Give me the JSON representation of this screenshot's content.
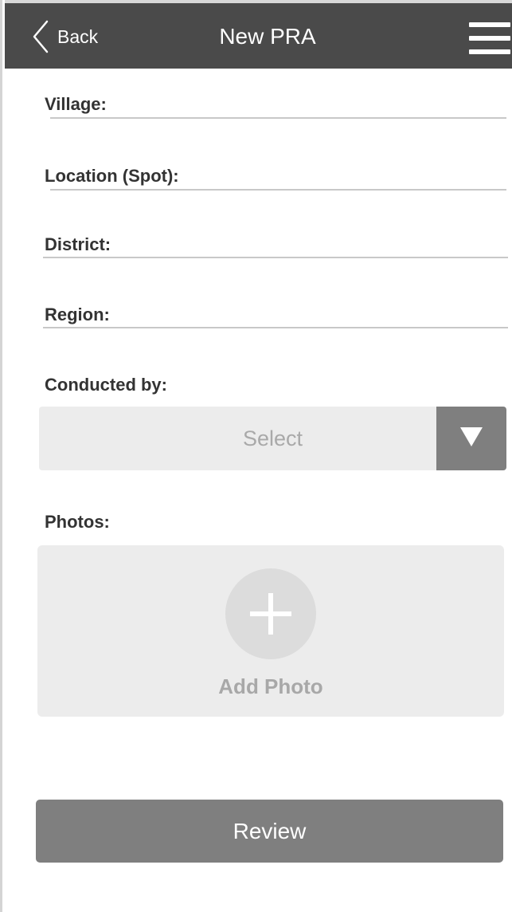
{
  "header": {
    "back_label": "Back",
    "title": "New PRA",
    "back_icon": "chevron-left-icon",
    "menu_icon": "hamburger-menu-icon",
    "background": "#4a4a4a"
  },
  "form": {
    "village_label": "Village:",
    "location_label": "Location (Spot):",
    "district_label": "District:",
    "region_label": "Region:",
    "conducted_by_label": "Conducted by:",
    "conducted_by_select": {
      "value": "Select",
      "icon": "triangle-down-icon"
    },
    "photos_label": "Photos:",
    "add_photo": {
      "label": "Add Photo",
      "icon": "plus-icon"
    }
  },
  "actions": {
    "review_label": "Review"
  },
  "colors": {
    "accent_gray": "#7f7f7f",
    "panel_gray": "#ececec",
    "text_dark": "#333333",
    "placeholder": "#a9a9a9"
  }
}
